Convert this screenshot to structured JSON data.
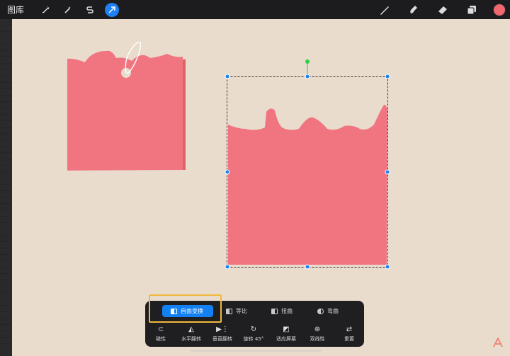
{
  "topbar": {
    "gallery_label": "图库",
    "tools": [
      {
        "icon": "wrench-icon"
      },
      {
        "icon": "magic-wand-icon"
      },
      {
        "icon": "selection-s-icon"
      },
      {
        "icon": "transform-arrow-icon",
        "active": true
      }
    ],
    "right_tools": [
      "brush-icon",
      "smudge-icon",
      "eraser-icon",
      "layers-icon"
    ],
    "current_color": "#f1676e"
  },
  "transform_modes": [
    {
      "label": "自由变换",
      "active": true
    },
    {
      "label": "等比",
      "active": false
    },
    {
      "label": "扭曲",
      "active": false
    },
    {
      "label": "弯曲",
      "active": false
    }
  ],
  "transform_actions": [
    {
      "label": "磁性",
      "icon": "magnet-icon"
    },
    {
      "label": "水平翻转",
      "icon": "flip-horizontal-icon"
    },
    {
      "label": "垂直翻转",
      "icon": "flip-vertical-icon"
    },
    {
      "label": "旋转 45°",
      "icon": "rotate-icon"
    },
    {
      "label": "适应屏幕",
      "icon": "fit-screen-icon"
    },
    {
      "label": "双线性",
      "icon": "bilinear-icon"
    },
    {
      "label": "重置",
      "icon": "reset-icon"
    }
  ],
  "colors": {
    "canvas": "#e9dccd",
    "shape": "#f07580",
    "accent": "#1e80f5",
    "highlight": "#f2b93c"
  }
}
